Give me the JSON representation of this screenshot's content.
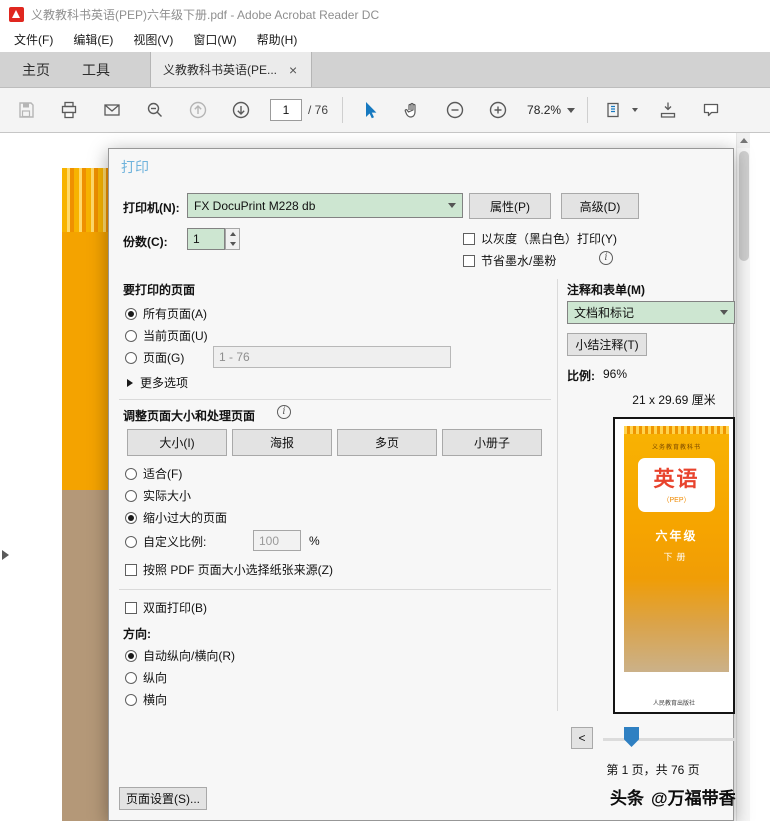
{
  "titlebar": {
    "title": "义教教科书英语(PEP)六年级下册.pdf - Adobe Acrobat Reader DC"
  },
  "menubar": {
    "items": [
      "文件(F)",
      "编辑(E)",
      "视图(V)",
      "窗口(W)",
      "帮助(H)"
    ]
  },
  "tabbar": {
    "home": "主页",
    "tools": "工具",
    "document": "义教教科书英语(PE...",
    "close": "×"
  },
  "toolbar": {
    "page_current": "1",
    "page_total": "/ 76",
    "zoom": "78.2%"
  },
  "dialog": {
    "title": "打印",
    "printer": {
      "label": "打印机(N):",
      "value": "FX DocuPrint M228 db",
      "properties": "属性(P)",
      "advanced": "高级(D)"
    },
    "copies": {
      "label": "份数(C):",
      "value": "1"
    },
    "grayscale": "以灰度（黑白色）打印(Y)",
    "save_ink": "节省墨水/墨粉",
    "pages": {
      "title": "要打印的页面",
      "all": "所有页面(A)",
      "current": "当前页面(U)",
      "range": "页面(G)",
      "range_value": "1 - 76",
      "more": "更多选项"
    },
    "sizing": {
      "title": "调整页面大小和处理页面",
      "size": "大小(I)",
      "poster": "海报",
      "multiple": "多页",
      "booklet": "小册子",
      "fit": "适合(F)",
      "actual": "实际大小",
      "shrink": "缩小过大的页面",
      "custom": "自定义比例:",
      "custom_value": "100",
      "percent": "%",
      "paper_source": "按照 PDF 页面大小选择纸张来源(Z)"
    },
    "duplex": "双面打印(B)",
    "orientation": {
      "title": "方向:",
      "auto": "自动纵向/横向(R)",
      "portrait": "纵向",
      "landscape": "横向"
    },
    "comments": {
      "title": "注释和表单(M)",
      "value": "文档和标记",
      "summarize": "小结注释(T)"
    },
    "scale": {
      "label": "比例:",
      "value": "96%"
    },
    "paper_size": "21 x 29.69 厘米",
    "preview": {
      "series": "义务教育教科书",
      "title": "英语",
      "pep": "（PEP）",
      "grade": "六年级",
      "volume": "下册",
      "publisher": "人民教育出版社"
    },
    "nav": {
      "prev": "<",
      "page_info": "第 1 页，共 76 页"
    },
    "page_setup": "页面设置(S)..."
  },
  "watermark": {
    "brand": "头条",
    "handle": "@万福带香"
  },
  "colors": {
    "field_green": "#cde6d1",
    "accent_blue": "#1679c0",
    "cover_orange": "#f4a300"
  }
}
